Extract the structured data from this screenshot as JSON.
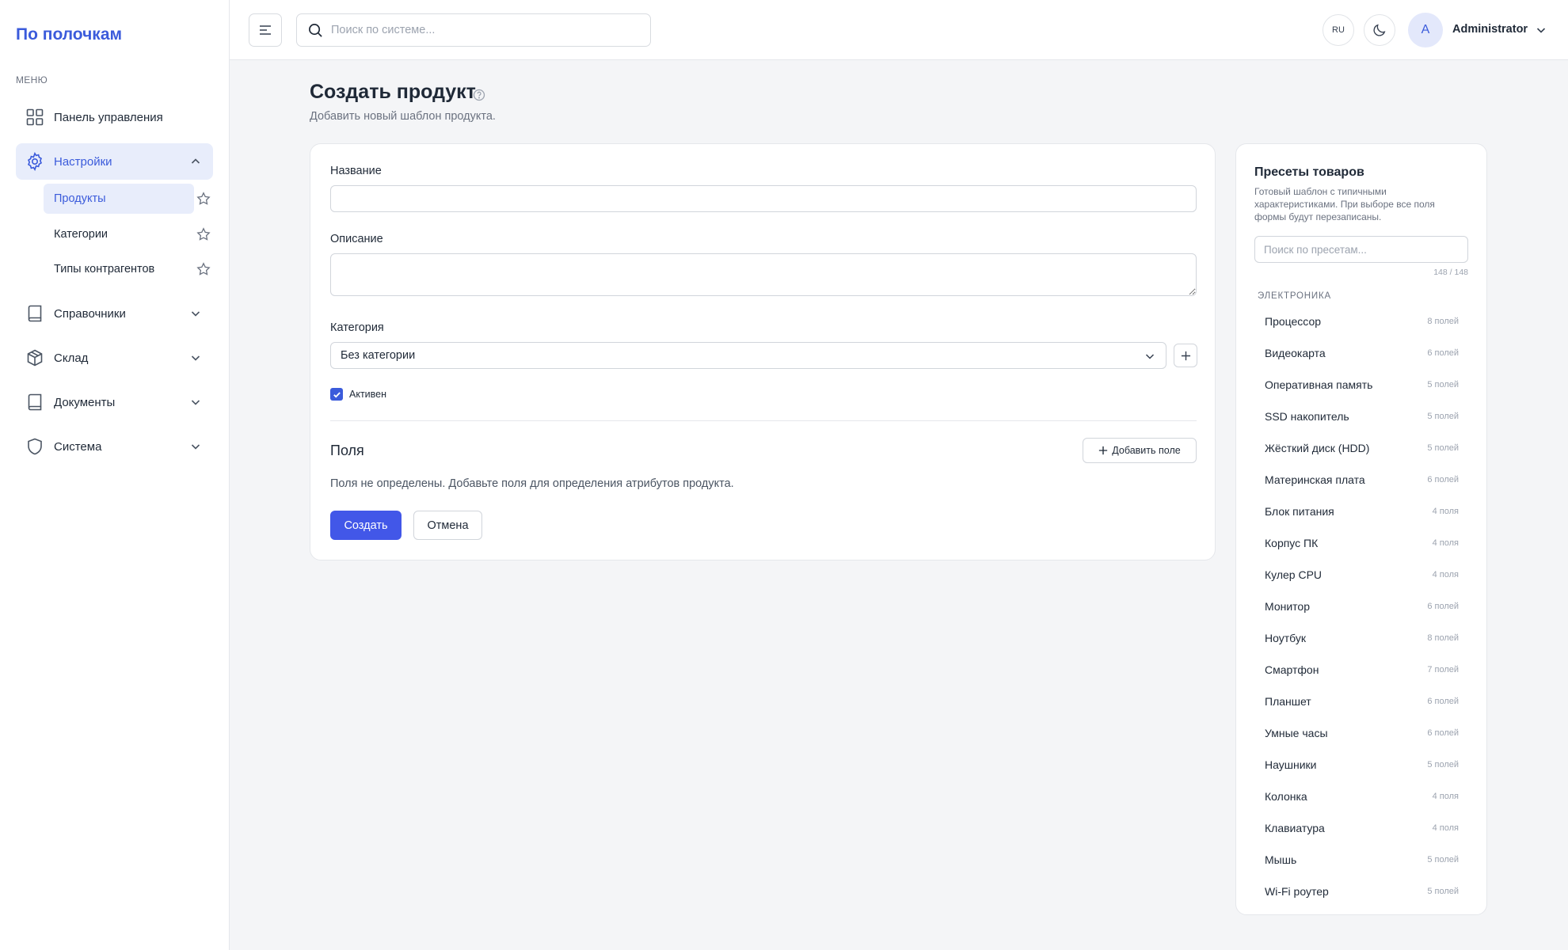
{
  "brand": "По полочкам",
  "sidebar": {
    "menu_caption": "МЕНЮ",
    "items": [
      {
        "label": "Панель управления"
      },
      {
        "label": "Настройки"
      },
      {
        "label": "Справочники"
      },
      {
        "label": "Склад"
      },
      {
        "label": "Документы"
      },
      {
        "label": "Система"
      }
    ],
    "settings_sub": [
      {
        "label": "Продукты",
        "active": true
      },
      {
        "label": "Категории"
      },
      {
        "label": "Типы контрагентов"
      }
    ]
  },
  "topbar": {
    "search_placeholder": "Поиск по системе...",
    "lang": "RU",
    "avatar_letter": "A",
    "user_name": "Administrator"
  },
  "page": {
    "title": "Создать продукт",
    "subtitle": "Добавить новый шаблон продукта."
  },
  "form": {
    "name_label": "Название",
    "name_value": "",
    "description_label": "Описание",
    "description_value": "",
    "category_label": "Категория",
    "category_value": "Без категории",
    "active_label": "Активен",
    "active_checked": true,
    "fields_title": "Поля",
    "add_field_label": "Добавить поле",
    "empty_fields_note": "Поля не определены. Добавьте поля для определения атрибутов продукта.",
    "create_label": "Создать",
    "cancel_label": "Отмена"
  },
  "presets": {
    "title": "Пресеты товаров",
    "description": "Готовый шаблон с типичными характеристиками. При выборе все поля формы будут перезаписаны.",
    "search_placeholder": "Поиск по пресетам...",
    "count_text": "148 / 148",
    "group_title": "ЭЛЕКТРОНИКА",
    "items": [
      {
        "name": "Процессор",
        "count": "8 полей"
      },
      {
        "name": "Видеокарта",
        "count": "6 полей"
      },
      {
        "name": "Оперативная память",
        "count": "5 полей"
      },
      {
        "name": "SSD накопитель",
        "count": "5 полей"
      },
      {
        "name": "Жёсткий диск (HDD)",
        "count": "5 полей"
      },
      {
        "name": "Материнская плата",
        "count": "6 полей"
      },
      {
        "name": "Блок питания",
        "count": "4 поля"
      },
      {
        "name": "Корпус ПК",
        "count": "4 поля"
      },
      {
        "name": "Кулер CPU",
        "count": "4 поля"
      },
      {
        "name": "Монитор",
        "count": "6 полей"
      },
      {
        "name": "Ноутбук",
        "count": "8 полей"
      },
      {
        "name": "Смартфон",
        "count": "7 полей"
      },
      {
        "name": "Планшет",
        "count": "6 полей"
      },
      {
        "name": "Умные часы",
        "count": "6 полей"
      },
      {
        "name": "Наушники",
        "count": "5 полей"
      },
      {
        "name": "Колонка",
        "count": "4 поля"
      },
      {
        "name": "Клавиатура",
        "count": "4 поля"
      },
      {
        "name": "Мышь",
        "count": "5 полей"
      },
      {
        "name": "Wi-Fi роутер",
        "count": "5 полей"
      }
    ]
  },
  "colors": {
    "accent": "#3b5bdb",
    "primary_button": "#4257e8",
    "active_bg": "#e8edfb",
    "page_bg": "#f4f5f7"
  },
  "icons": [
    "dashboard-icon",
    "gear-icon",
    "book-icon",
    "box-icon",
    "document-icon",
    "shield-icon",
    "star-icon",
    "chevron-down-icon",
    "chevron-up-icon",
    "menu-icon",
    "search-icon",
    "moon-icon",
    "help-icon",
    "plus-icon",
    "check-icon"
  ]
}
